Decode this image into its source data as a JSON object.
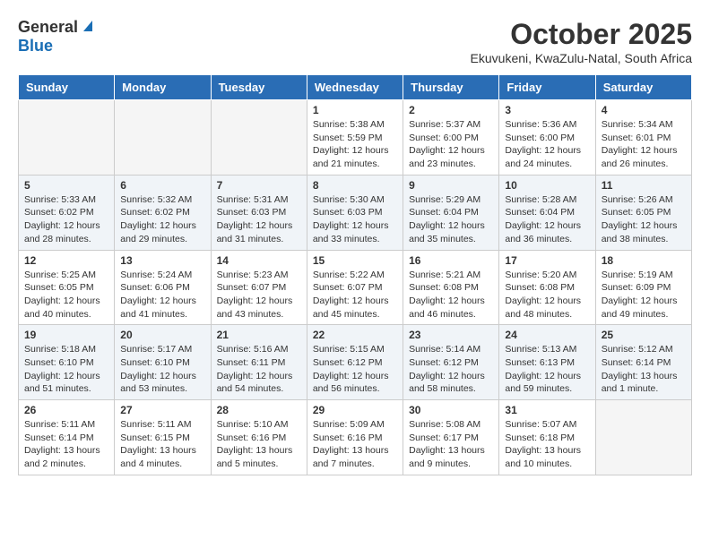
{
  "header": {
    "logo_general": "General",
    "logo_blue": "Blue",
    "month_title": "October 2025",
    "location": "Ekuvukeni, KwaZulu-Natal, South Africa"
  },
  "days_of_week": [
    "Sunday",
    "Monday",
    "Tuesday",
    "Wednesday",
    "Thursday",
    "Friday",
    "Saturday"
  ],
  "weeks": [
    {
      "days": [
        {
          "date": "",
          "empty": true
        },
        {
          "date": "",
          "empty": true
        },
        {
          "date": "",
          "empty": true
        },
        {
          "date": "1",
          "sunrise": "Sunrise: 5:38 AM",
          "sunset": "Sunset: 5:59 PM",
          "daylight": "Daylight: 12 hours and 21 minutes."
        },
        {
          "date": "2",
          "sunrise": "Sunrise: 5:37 AM",
          "sunset": "Sunset: 6:00 PM",
          "daylight": "Daylight: 12 hours and 23 minutes."
        },
        {
          "date": "3",
          "sunrise": "Sunrise: 5:36 AM",
          "sunset": "Sunset: 6:00 PM",
          "daylight": "Daylight: 12 hours and 24 minutes."
        },
        {
          "date": "4",
          "sunrise": "Sunrise: 5:34 AM",
          "sunset": "Sunset: 6:01 PM",
          "daylight": "Daylight: 12 hours and 26 minutes."
        }
      ]
    },
    {
      "days": [
        {
          "date": "5",
          "sunrise": "Sunrise: 5:33 AM",
          "sunset": "Sunset: 6:02 PM",
          "daylight": "Daylight: 12 hours and 28 minutes."
        },
        {
          "date": "6",
          "sunrise": "Sunrise: 5:32 AM",
          "sunset": "Sunset: 6:02 PM",
          "daylight": "Daylight: 12 hours and 29 minutes."
        },
        {
          "date": "7",
          "sunrise": "Sunrise: 5:31 AM",
          "sunset": "Sunset: 6:03 PM",
          "daylight": "Daylight: 12 hours and 31 minutes."
        },
        {
          "date": "8",
          "sunrise": "Sunrise: 5:30 AM",
          "sunset": "Sunset: 6:03 PM",
          "daylight": "Daylight: 12 hours and 33 minutes."
        },
        {
          "date": "9",
          "sunrise": "Sunrise: 5:29 AM",
          "sunset": "Sunset: 6:04 PM",
          "daylight": "Daylight: 12 hours and 35 minutes."
        },
        {
          "date": "10",
          "sunrise": "Sunrise: 5:28 AM",
          "sunset": "Sunset: 6:04 PM",
          "daylight": "Daylight: 12 hours and 36 minutes."
        },
        {
          "date": "11",
          "sunrise": "Sunrise: 5:26 AM",
          "sunset": "Sunset: 6:05 PM",
          "daylight": "Daylight: 12 hours and 38 minutes."
        }
      ]
    },
    {
      "days": [
        {
          "date": "12",
          "sunrise": "Sunrise: 5:25 AM",
          "sunset": "Sunset: 6:05 PM",
          "daylight": "Daylight: 12 hours and 40 minutes."
        },
        {
          "date": "13",
          "sunrise": "Sunrise: 5:24 AM",
          "sunset": "Sunset: 6:06 PM",
          "daylight": "Daylight: 12 hours and 41 minutes."
        },
        {
          "date": "14",
          "sunrise": "Sunrise: 5:23 AM",
          "sunset": "Sunset: 6:07 PM",
          "daylight": "Daylight: 12 hours and 43 minutes."
        },
        {
          "date": "15",
          "sunrise": "Sunrise: 5:22 AM",
          "sunset": "Sunset: 6:07 PM",
          "daylight": "Daylight: 12 hours and 45 minutes."
        },
        {
          "date": "16",
          "sunrise": "Sunrise: 5:21 AM",
          "sunset": "Sunset: 6:08 PM",
          "daylight": "Daylight: 12 hours and 46 minutes."
        },
        {
          "date": "17",
          "sunrise": "Sunrise: 5:20 AM",
          "sunset": "Sunset: 6:08 PM",
          "daylight": "Daylight: 12 hours and 48 minutes."
        },
        {
          "date": "18",
          "sunrise": "Sunrise: 5:19 AM",
          "sunset": "Sunset: 6:09 PM",
          "daylight": "Daylight: 12 hours and 49 minutes."
        }
      ]
    },
    {
      "days": [
        {
          "date": "19",
          "sunrise": "Sunrise: 5:18 AM",
          "sunset": "Sunset: 6:10 PM",
          "daylight": "Daylight: 12 hours and 51 minutes."
        },
        {
          "date": "20",
          "sunrise": "Sunrise: 5:17 AM",
          "sunset": "Sunset: 6:10 PM",
          "daylight": "Daylight: 12 hours and 53 minutes."
        },
        {
          "date": "21",
          "sunrise": "Sunrise: 5:16 AM",
          "sunset": "Sunset: 6:11 PM",
          "daylight": "Daylight: 12 hours and 54 minutes."
        },
        {
          "date": "22",
          "sunrise": "Sunrise: 5:15 AM",
          "sunset": "Sunset: 6:12 PM",
          "daylight": "Daylight: 12 hours and 56 minutes."
        },
        {
          "date": "23",
          "sunrise": "Sunrise: 5:14 AM",
          "sunset": "Sunset: 6:12 PM",
          "daylight": "Daylight: 12 hours and 58 minutes."
        },
        {
          "date": "24",
          "sunrise": "Sunrise: 5:13 AM",
          "sunset": "Sunset: 6:13 PM",
          "daylight": "Daylight: 12 hours and 59 minutes."
        },
        {
          "date": "25",
          "sunrise": "Sunrise: 5:12 AM",
          "sunset": "Sunset: 6:14 PM",
          "daylight": "Daylight: 13 hours and 1 minute."
        }
      ]
    },
    {
      "days": [
        {
          "date": "26",
          "sunrise": "Sunrise: 5:11 AM",
          "sunset": "Sunset: 6:14 PM",
          "daylight": "Daylight: 13 hours and 2 minutes."
        },
        {
          "date": "27",
          "sunrise": "Sunrise: 5:11 AM",
          "sunset": "Sunset: 6:15 PM",
          "daylight": "Daylight: 13 hours and 4 minutes."
        },
        {
          "date": "28",
          "sunrise": "Sunrise: 5:10 AM",
          "sunset": "Sunset: 6:16 PM",
          "daylight": "Daylight: 13 hours and 5 minutes."
        },
        {
          "date": "29",
          "sunrise": "Sunrise: 5:09 AM",
          "sunset": "Sunset: 6:16 PM",
          "daylight": "Daylight: 13 hours and 7 minutes."
        },
        {
          "date": "30",
          "sunrise": "Sunrise: 5:08 AM",
          "sunset": "Sunset: 6:17 PM",
          "daylight": "Daylight: 13 hours and 9 minutes."
        },
        {
          "date": "31",
          "sunrise": "Sunrise: 5:07 AM",
          "sunset": "Sunset: 6:18 PM",
          "daylight": "Daylight: 13 hours and 10 minutes."
        },
        {
          "date": "",
          "empty": true
        }
      ]
    }
  ]
}
